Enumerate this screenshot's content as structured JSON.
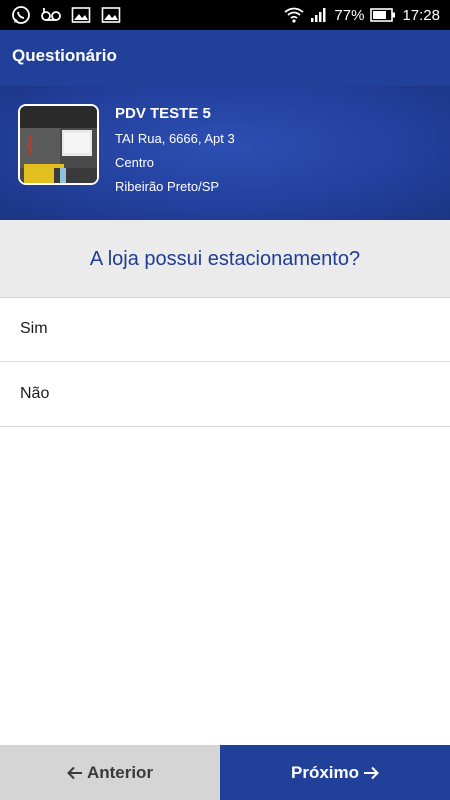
{
  "status_bar": {
    "battery_percent": "77%",
    "time": "17:28",
    "icons": [
      "whatsapp-icon",
      "voicemail-icon",
      "image-icon",
      "image-icon",
      "wifi-icon",
      "signal-icon",
      "battery-icon"
    ]
  },
  "app_bar": {
    "title": "Questionário"
  },
  "store": {
    "name": "PDV TESTE 5",
    "address": "TAI Rua, 6666, Apt 3",
    "district": "Centro",
    "city": "Ribeirão Preto/SP"
  },
  "question": {
    "text": "A loja possui estacionamento?"
  },
  "options": [
    {
      "label": "Sim"
    },
    {
      "label": "Não"
    }
  ],
  "navigation": {
    "prev_label": "Anterior",
    "next_label": "Próximo"
  },
  "colors": {
    "primary": "#21409a",
    "question_text": "#1f3d93",
    "question_bg": "#ebebeb",
    "prev_button_bg": "#d5d5d5"
  }
}
